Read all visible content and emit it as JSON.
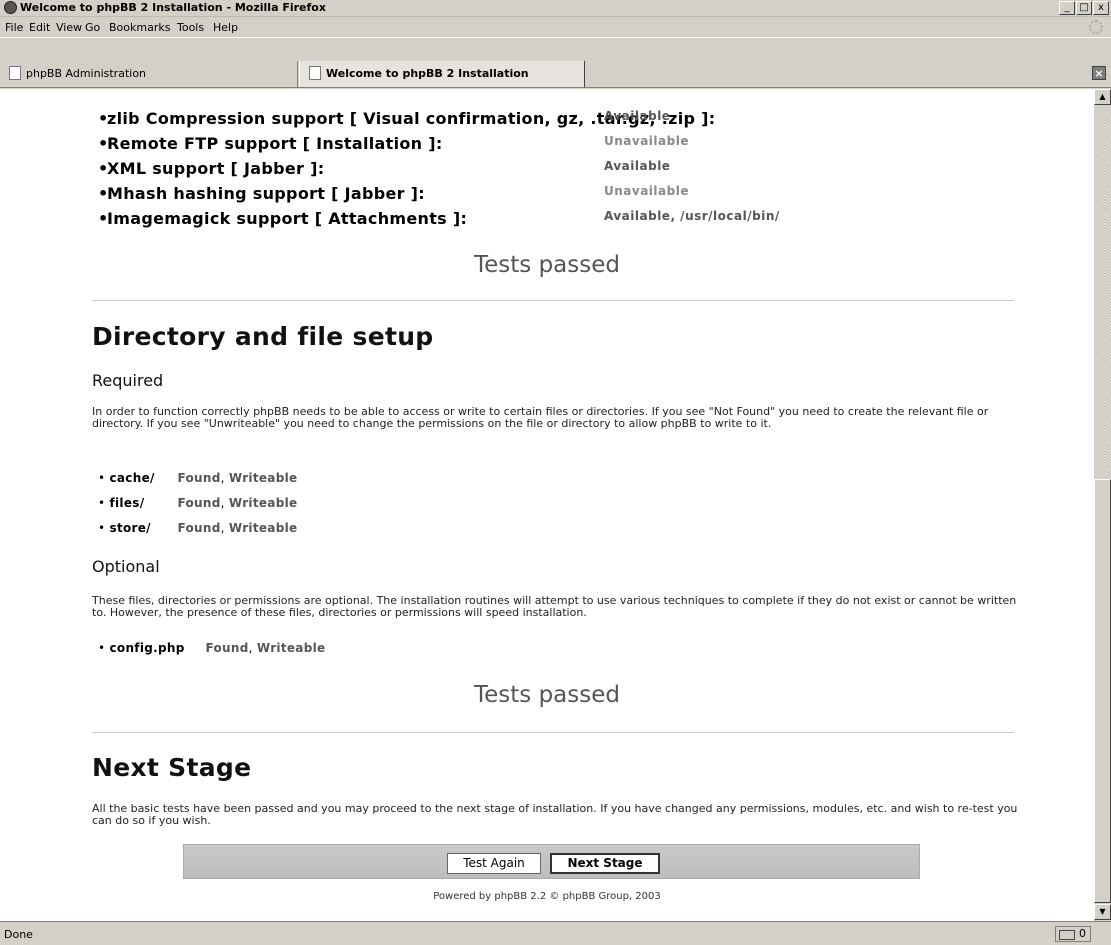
{
  "window": {
    "title": "Welcome to phpBB 2 Installation - Mozilla Firefox",
    "controls": [
      "_",
      "□",
      "x"
    ]
  },
  "menubar": [
    {
      "label": "File"
    },
    {
      "label": "Edit"
    },
    {
      "label": "View"
    },
    {
      "label": "Go"
    },
    {
      "label": "Bookmarks"
    },
    {
      "label": "Tools"
    },
    {
      "label": "Help"
    }
  ],
  "tabs": [
    {
      "label": "phpBB Administration",
      "active": false
    },
    {
      "label": "Welcome to phpBB 2 Installation",
      "active": true
    }
  ],
  "requirements": [
    {
      "label": "zlib Compression support [ Visual confirmation, gz, .tar.gz, .zip ]:",
      "status": "Available",
      "ok": true
    },
    {
      "label": "Remote FTP support [ Installation ]:",
      "status": "Unavailable",
      "ok": false
    },
    {
      "label": "XML support [ Jabber ]:",
      "status": "Available",
      "ok": true
    },
    {
      "label": "Mhash hashing support [ Jabber ]:",
      "status": "Unavailable",
      "ok": false
    },
    {
      "label": "Imagemagick support [ Attachments ]:",
      "status": "Available, /usr/local/bin/",
      "ok": true
    }
  ],
  "tests_passed_1": "Tests passed",
  "directory": {
    "heading": "Directory and file setup",
    "required_heading": "Required",
    "required_desc": "In order to function correctly phpBB needs to be able to access or write to certain files or directories. If you see \"Not Found\" you need to create the relevant file or directory. If you see \"Unwriteable\" you need to change the permissions on the file or directory to allow phpBB to write to it.",
    "required_items": [
      {
        "name": "cache/",
        "found": "Found",
        "writeable": "Writeable"
      },
      {
        "name": "files/",
        "found": "Found",
        "writeable": "Writeable"
      },
      {
        "name": "store/",
        "found": "Found",
        "writeable": "Writeable"
      }
    ],
    "optional_heading": "Optional",
    "optional_desc": "These files, directories or permissions are optional. The installation routines will attempt to use various techniques to complete if they do not exist or cannot be written to. However, the presence of these files, directories or permissions will speed installation.",
    "optional_items": [
      {
        "name": "config.php",
        "found": "Found",
        "writeable": "Writeable"
      }
    ]
  },
  "tests_passed_2": "Tests passed",
  "next_stage": {
    "heading": "Next Stage",
    "desc": "All the basic tests have been passed and you may proceed to the next stage of installation. If you have changed any permissions, modules, etc. and wish to re-test you can do so if you wish.",
    "test_again_label": "Test Again",
    "next_stage_label": "Next Stage"
  },
  "footer": "Powered by phpBB 2.2 © phpBB Group, 2003",
  "statusbar": {
    "status": "Done",
    "mail_count": "0"
  },
  "colors": {
    "available": "#555555",
    "unavailable": "#888888"
  }
}
